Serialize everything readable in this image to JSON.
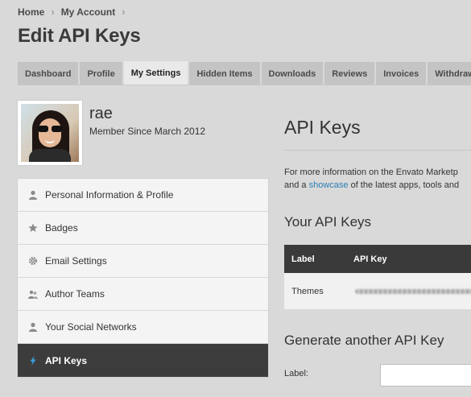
{
  "breadcrumb": [
    "Home",
    "My Account"
  ],
  "page_title": "Edit API Keys",
  "tabs": [
    {
      "label": "Dashboard",
      "active": false
    },
    {
      "label": "Profile",
      "active": false
    },
    {
      "label": "My Settings",
      "active": true
    },
    {
      "label": "Hidden Items",
      "active": false
    },
    {
      "label": "Downloads",
      "active": false
    },
    {
      "label": "Reviews",
      "active": false
    },
    {
      "label": "Invoices",
      "active": false
    },
    {
      "label": "Withdraw",
      "active": false
    }
  ],
  "profile": {
    "name": "rae",
    "member_since": "Member Since March 2012"
  },
  "sidebar": {
    "items": [
      {
        "label": "Personal Information & Profile",
        "icon": "person-icon",
        "active": false
      },
      {
        "label": "Badges",
        "icon": "star-icon",
        "active": false
      },
      {
        "label": "Email Settings",
        "icon": "gear-icon",
        "active": false
      },
      {
        "label": "Author Teams",
        "icon": "team-icon",
        "active": false
      },
      {
        "label": "Your Social Networks",
        "icon": "person-icon",
        "active": false
      },
      {
        "label": "API Keys",
        "icon": "lightning-icon",
        "active": true
      }
    ]
  },
  "main": {
    "title": "API Keys",
    "intro_line1": "For more information on the Envato Marketp",
    "intro_line2_pre": "and a ",
    "intro_link": "showcase",
    "intro_line2_post": " of the latest apps, tools and",
    "your_keys_title": "Your API Keys",
    "table": {
      "headers": [
        "Label",
        "API Key"
      ],
      "rows": [
        {
          "label": "Themes"
        }
      ]
    },
    "generate_title": "Generate another API Key",
    "form_label": "Label:",
    "form_value": ""
  },
  "colors": {
    "accent_link": "#2a7fb6",
    "active_nav": "#3c3c3c",
    "lightning": "#3aa0e0"
  }
}
